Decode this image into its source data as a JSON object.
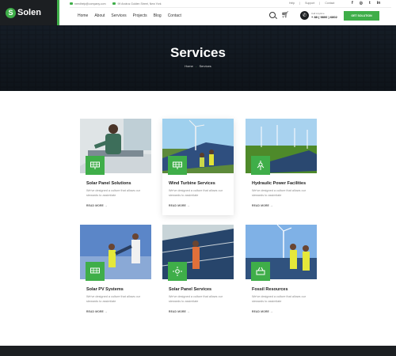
{
  "brand": {
    "name": "Solen",
    "accent": "#3fae49",
    "dark": "#1c1f22"
  },
  "topinfo": {
    "email": "needhelp@company.com",
    "address": "99 Andrus Golden Street, New York"
  },
  "toplinks": [
    "Help",
    "Support",
    "Contact"
  ],
  "socials": [
    {
      "name": "facebook-icon",
      "glyph": "f"
    },
    {
      "name": "instagram-icon",
      "glyph": "◎"
    },
    {
      "name": "twitter-icon",
      "glyph": "t"
    },
    {
      "name": "linkedin-icon",
      "glyph": "in"
    }
  ],
  "nav": [
    "Home",
    "About",
    "Services",
    "Projects",
    "Blog",
    "Contact"
  ],
  "call": {
    "label": "Call Anytime",
    "number": "+ 88 ( 9800 ) 6802"
  },
  "cta": "GET SOLUTION",
  "hero": {
    "title": "Services",
    "crumb_home": "Home",
    "crumb_sep": "-",
    "crumb_current": "Services"
  },
  "cards": [
    {
      "title": "Solar Panel Solutions",
      "desc": "We've designed a culture that allows our stewards to assimilate",
      "more": "READ MORE →"
    },
    {
      "title": "Wind Turbine Services",
      "desc": "We've designed a culture that allows our stewards to assimilate",
      "more": "READ MORE →"
    },
    {
      "title": "Hydraulic Power Facilities",
      "desc": "We've designed a culture that allows our stewards to assimilate",
      "more": "READ MORE →"
    },
    {
      "title": "Solar PV Systems",
      "desc": "We've designed a culture that allows our stewards to assimilate",
      "more": "READ MORE →"
    },
    {
      "title": "Solar Panel Services",
      "desc": "We've designed a culture that allows our stewards to assimilate",
      "more": "READ MORE →"
    },
    {
      "title": "Fossil Resources",
      "desc": "We've designed a culture that allows our stewards to assimilate",
      "more": "READ MORE →"
    }
  ]
}
